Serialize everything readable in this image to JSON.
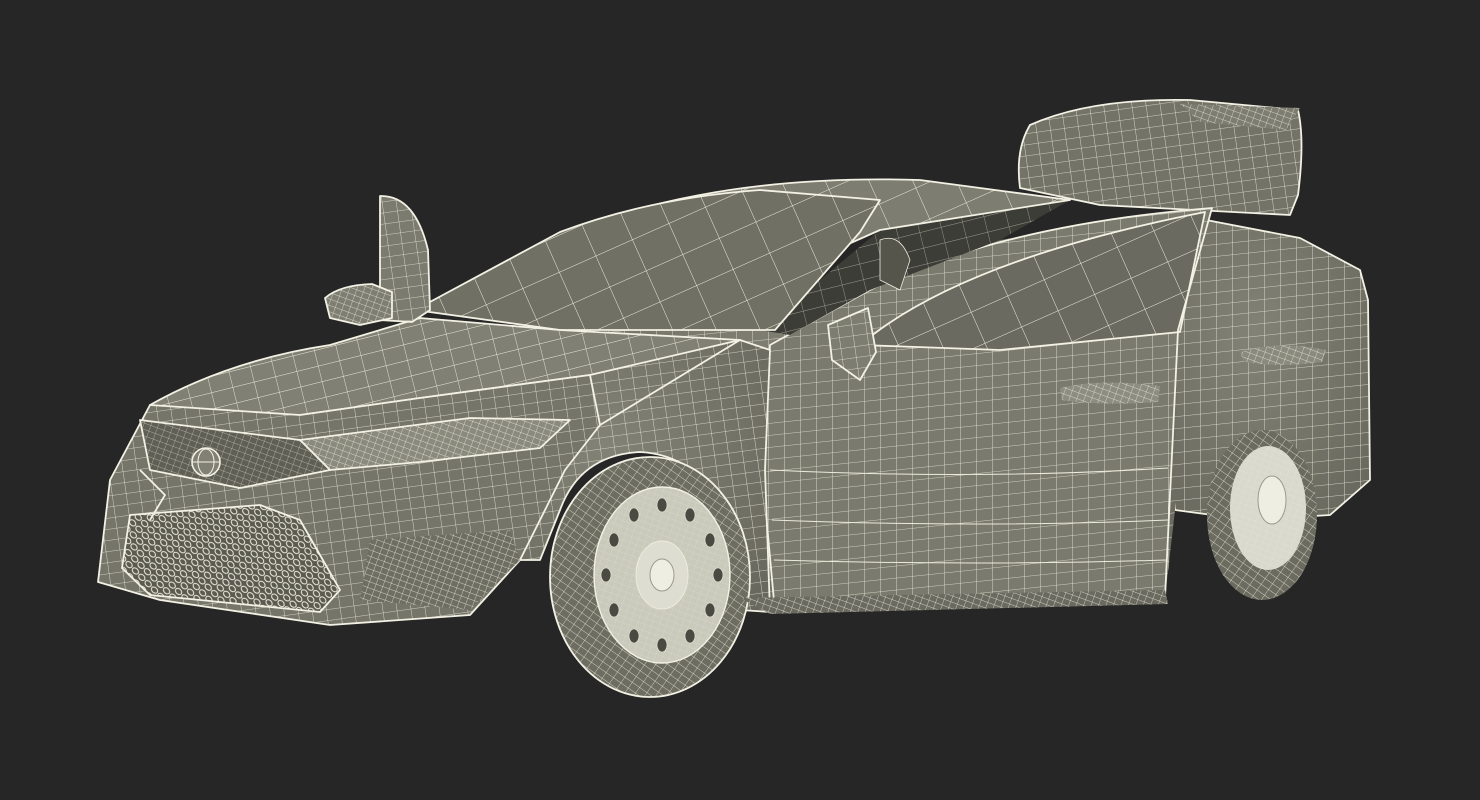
{
  "scene": {
    "subject": "car-wireframe-render",
    "background_color": "#262626",
    "body_color": "#77776b",
    "shadow_color": "#5e5e54",
    "glass_color": "#4a4a43",
    "wire_color": "#ecebdc",
    "tyre_color": "#6f6f64",
    "rim_color": "#cfcfc2"
  }
}
